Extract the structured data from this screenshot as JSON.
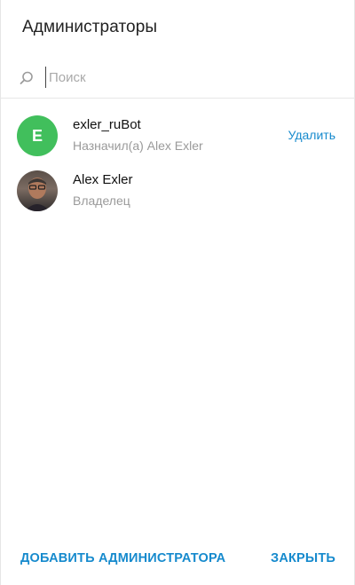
{
  "dialog": {
    "title": "Администраторы"
  },
  "search": {
    "placeholder": "Поиск",
    "value": ""
  },
  "admins": [
    {
      "name": "exler_ruBot",
      "subtitle": "Назначил(а) Alex Exler",
      "avatar_letter": "E",
      "avatar_color": "#41bf5c",
      "action_label": "Удалить"
    },
    {
      "name": "Alex Exler",
      "subtitle": "Владелец",
      "avatar_type": "photo"
    }
  ],
  "footer": {
    "add_label": "ДОБАВИТЬ АДМИНИСТРАТОРА",
    "close_label": "ЗАКРЫТЬ"
  },
  "colors": {
    "accent": "#168acd",
    "avatar_green": "#41bf5c",
    "muted_text": "#9a9a9a"
  }
}
